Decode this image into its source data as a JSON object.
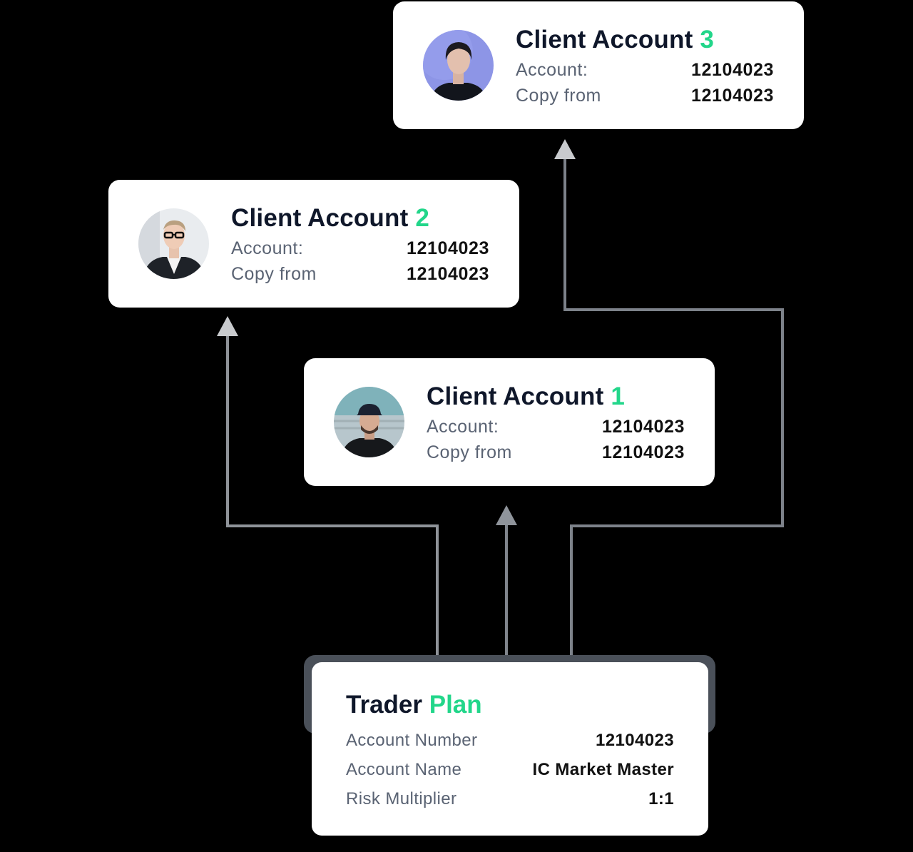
{
  "clients": [
    {
      "title_prefix": "Client Account",
      "number": "3",
      "account_label": "Account:",
      "account_value": "12104023",
      "copy_label": "Copy from",
      "copy_value": "12104023"
    },
    {
      "title_prefix": "Client Account",
      "number": "2",
      "account_label": "Account:",
      "account_value": "12104023",
      "copy_label": "Copy from",
      "copy_value": "12104023"
    },
    {
      "title_prefix": "Client Account",
      "number": "1",
      "account_label": "Account:",
      "account_value": "12104023",
      "copy_label": "Copy from",
      "copy_value": "12104023"
    }
  ],
  "plan": {
    "title": "Trader",
    "title_accent": "Plan",
    "rows": [
      {
        "label": "Account Number",
        "value": "12104023"
      },
      {
        "label": "Account Name",
        "value": "IC Market Master"
      },
      {
        "label": "Risk Multiplier",
        "value": "1:1"
      }
    ]
  },
  "colors": {
    "accent": "#22d68a",
    "background": "#000000",
    "card": "#ffffff",
    "title": "#0f172a",
    "label": "#5a6373",
    "connector": "#8a9099"
  }
}
